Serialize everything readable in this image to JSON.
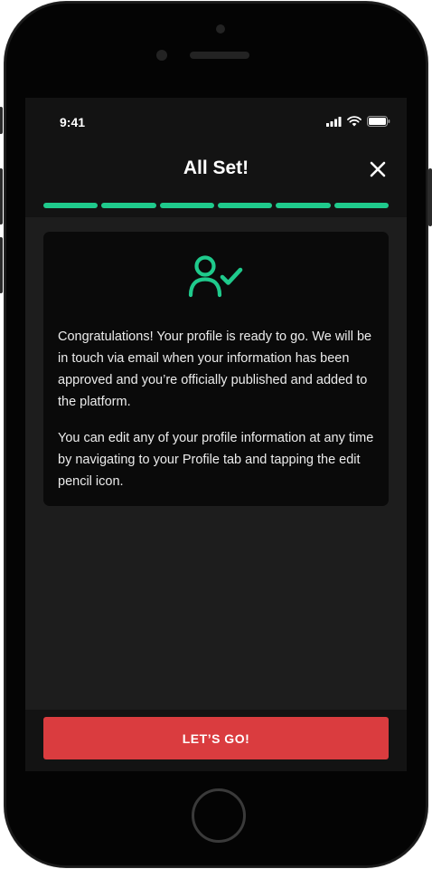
{
  "status_bar": {
    "time": "9:41"
  },
  "header": {
    "title": "All Set!"
  },
  "progress": {
    "total_steps": 6,
    "completed_steps": 6
  },
  "card": {
    "paragraph_1": "Congratulations! Your profile is ready to go. We will be in touch via email when your information has been approved and you’re officially published and added to the platform.",
    "paragraph_2": "You can edit any of your profile information at any time by navigating to your Profile tab and tapping the edit pencil icon."
  },
  "footer": {
    "cta_label": "LET’S GO!"
  },
  "colors": {
    "accent": "#1fca8c",
    "cta": "#da3c3f",
    "screen_bg": "#1d1d1d",
    "card_bg": "#0a0a0a"
  },
  "icons": [
    "signal-icon",
    "wifi-icon",
    "battery-icon",
    "close-icon",
    "user-check-icon"
  ]
}
